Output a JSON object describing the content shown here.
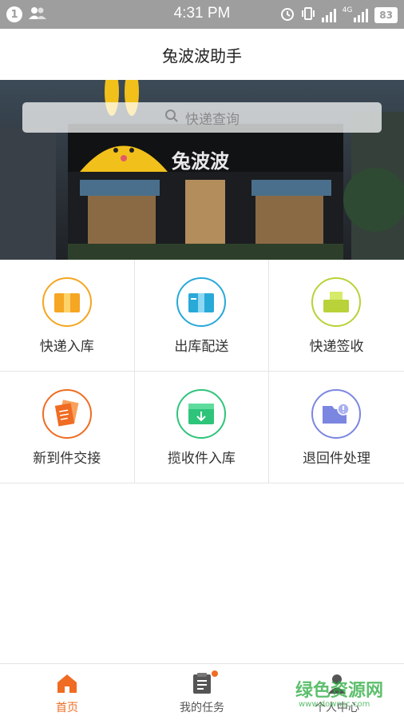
{
  "status_bar": {
    "notification_count": "1",
    "time": "4:31 PM",
    "network": "4G",
    "battery": "83"
  },
  "header": {
    "title": "兔波波助手"
  },
  "banner": {
    "search_placeholder": "快递查询",
    "store_sign": "兔波波"
  },
  "grid": {
    "items": [
      {
        "label": "快递入库",
        "icon": "package-in-icon",
        "color": "#f5a623"
      },
      {
        "label": "出库配送",
        "icon": "package-out-icon",
        "color": "#29a9d8"
      },
      {
        "label": "快递签收",
        "icon": "package-sign-icon",
        "color": "#b9d23a"
      },
      {
        "label": "新到件交接",
        "icon": "documents-icon",
        "color": "#ef6c22"
      },
      {
        "label": "揽收件入库",
        "icon": "inbox-download-icon",
        "color": "#2ec47a"
      },
      {
        "label": "退回件处理",
        "icon": "folder-alert-icon",
        "color": "#7b86e0"
      }
    ]
  },
  "tabbar": {
    "tabs": [
      {
        "label": "首页",
        "icon": "home-icon"
      },
      {
        "label": "我的任务",
        "icon": "clipboard-icon"
      },
      {
        "label": "个人中心",
        "icon": "user-icon"
      }
    ],
    "active_color": "#ef6c22"
  },
  "watermark": {
    "text": "绿色资源网",
    "url_text": "www.downcc.com"
  }
}
